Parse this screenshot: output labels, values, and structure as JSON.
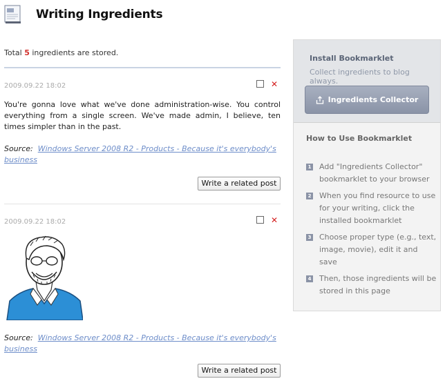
{
  "header": {
    "title": "Writing Ingredients"
  },
  "summary": {
    "prefix": "Total ",
    "count": "5",
    "suffix": " ingredients are stored."
  },
  "posts": [
    {
      "date": "2009.09.22 18:02",
      "body": "You're gonna love what we've done administration-wise. You control everything from a single screen. We've made admin, I believe, ten times simpler than in the past.",
      "source_label": "Source:",
      "source_link": "Windows Server 2008 R2 - Products - Because it's everybody's business",
      "related_button": "Write a related post"
    },
    {
      "date": "2009.09.22 18:02",
      "source_label": "Source:",
      "source_link": "Windows Server 2008 R2 - Products - Because it's everybody's business",
      "related_button": "Write a related post"
    }
  ],
  "sidebar": {
    "install_title": "Install Bookmarklet",
    "install_subtitle": "Collect ingredients to blog always.",
    "collector_button": "Ingredients Collector",
    "howto_title": "How to Use Bookmarklet",
    "steps": [
      {
        "num": "1",
        "text": "Add \"Ingredients Collector\" bookmarklet to your browser"
      },
      {
        "num": "2",
        "text": "When you find resource to use for your writing, click the installed bookmarklet"
      },
      {
        "num": "3",
        "text": "Choose proper type (e.g., text, image, movie), edit it and save"
      },
      {
        "num": "4",
        "text": "Then, those ingredients will be stored in this page"
      }
    ]
  },
  "colors": {
    "count": "#d0312d",
    "link": "#6d8dc9",
    "delete": "#d42020",
    "button_accent": "#8a93a7"
  }
}
